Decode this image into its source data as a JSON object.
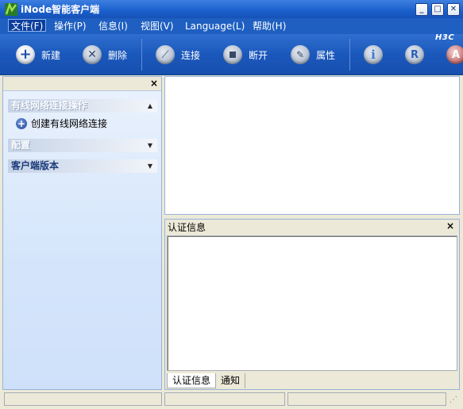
{
  "window": {
    "title": "iNode智能客户端",
    "controls": {
      "minimize": "_",
      "maximize": "□",
      "close": "✕"
    }
  },
  "menu": [
    {
      "label": "文件(F)",
      "active": true
    },
    {
      "label": "操作(P)"
    },
    {
      "label": "信息(I)"
    },
    {
      "label": "视图(V)"
    },
    {
      "label": "Language(L)"
    },
    {
      "label": "帮助(H)"
    }
  ],
  "toolbar": {
    "new": "新建",
    "delete": "删除",
    "connect": "连接",
    "disconnect": "断开",
    "properties": "属性",
    "brand": "H3C",
    "colors": {
      "bg": "#1b58bc",
      "icon_new": "#ffffff",
      "icon_gray": "#b8c4d6",
      "icon_i": "#3f78cf",
      "icon_r": "#2b5fb8",
      "icon_a": "#cc2b2b"
    }
  },
  "left_panel": {
    "sections": [
      {
        "title": "有线网络连接操作",
        "expanded": true,
        "items": [
          "创建有线网络连接"
        ]
      },
      {
        "title": "配置",
        "expanded": false
      },
      {
        "title": "客户端版本",
        "expanded": false
      }
    ],
    "close": "×"
  },
  "auth_panel": {
    "title": "认证信息",
    "close": "×",
    "tabs": [
      "认证信息",
      "通知"
    ]
  }
}
